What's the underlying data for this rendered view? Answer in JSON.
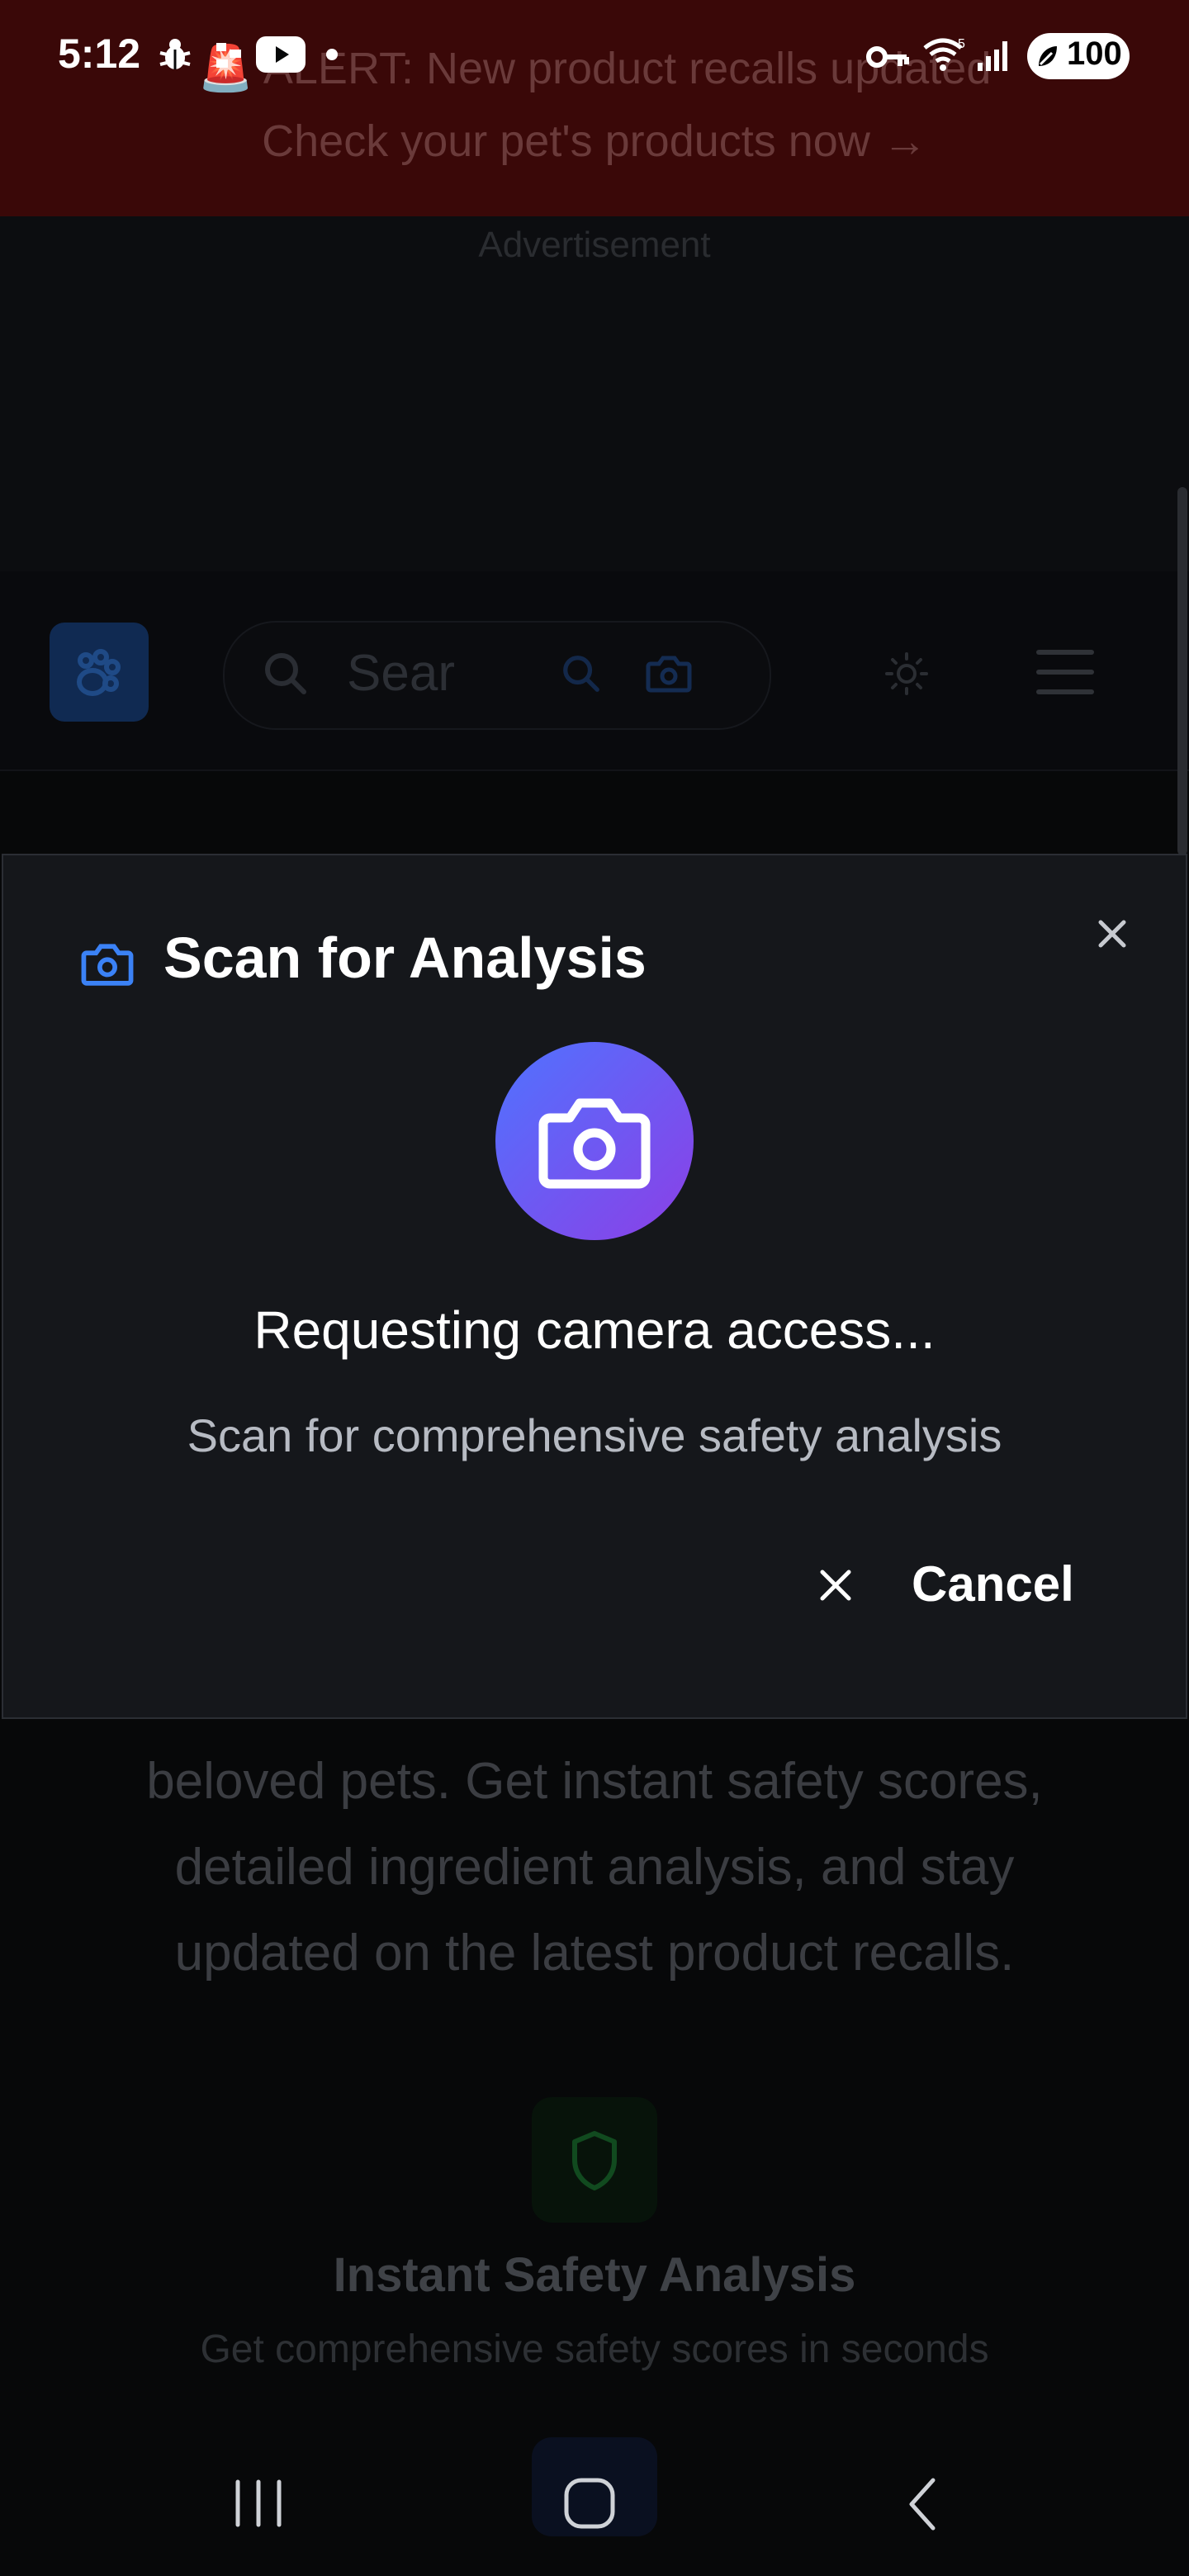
{
  "status_bar": {
    "time": "5:12",
    "battery": "100",
    "icons": [
      "bug-icon",
      "dots-icon",
      "youtube-icon",
      "dot-icon",
      "key-icon",
      "wifi-icon",
      "signal-icon",
      "battery-icon"
    ]
  },
  "alert_banner": {
    "line1": "🚨 ALERT: New product recalls updated",
    "line2": "Check your pet's products now →"
  },
  "ad": {
    "label": "Advertisement"
  },
  "header": {
    "logo_icon": "paw-icon",
    "search_placeholder": "Sear",
    "icons": [
      "search-icon",
      "search-submit-icon",
      "camera-icon",
      "sun-icon",
      "menu-icon"
    ]
  },
  "hero": {
    "line1": "beloved pets. Get instant safety scores,",
    "line2": "detailed ingredient analysis, and stay",
    "line3": "updated on the latest product recalls."
  },
  "feature": {
    "icon": "shield-icon",
    "title": "Instant Safety Analysis",
    "subtitle": "Get comprehensive safety scores in seconds"
  },
  "modal": {
    "title": "Scan for Analysis",
    "status": "Requesting camera access...",
    "subtitle": "Scan for comprehensive safety analysis",
    "cancel_label": "Cancel"
  },
  "nav_bar": {
    "icons": [
      "recent-apps-icon",
      "home-icon",
      "back-icon"
    ]
  },
  "colors": {
    "modal_bg": "#15171b",
    "accent_blue": "#4f73ff",
    "accent_purple": "#8c3fe6",
    "alert_bg": "#3a0808"
  }
}
